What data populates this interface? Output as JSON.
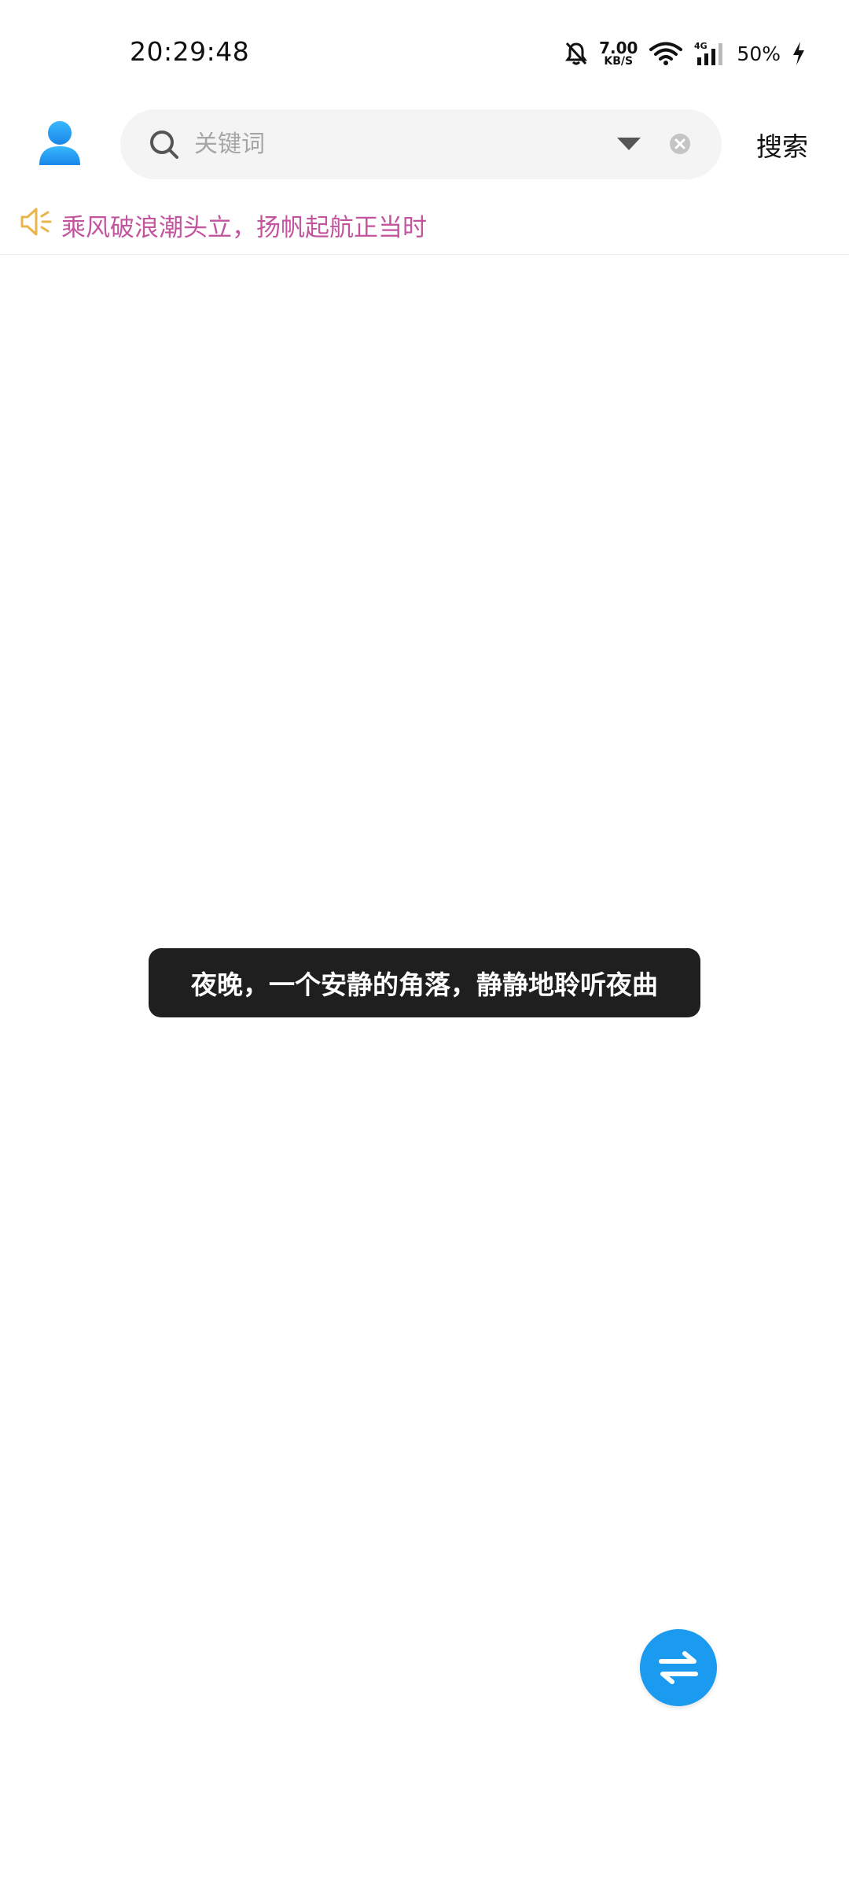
{
  "status_bar": {
    "time": "20:29:48",
    "net_speed_value": "7.00",
    "net_speed_unit": "KB/S",
    "battery_percent": "50%",
    "icons": [
      "bell-muted-icon",
      "wifi-icon",
      "signal-4g-icon",
      "charging-icon"
    ]
  },
  "header": {
    "search": {
      "placeholder": "关键词",
      "value": ""
    },
    "search_button_label": "搜索",
    "icons": [
      "user-avatar-icon",
      "search-icon",
      "dropdown-icon",
      "clear-icon"
    ]
  },
  "notice": {
    "text": "乘风破浪潮头立，扬帆起航正当时",
    "icon": "speaker-icon"
  },
  "toast": {
    "text": "夜晚，一个安静的角落，静静地聆听夜曲"
  },
  "fab": {
    "icon": "swap-arrows-icon"
  },
  "colors": {
    "accent": "#1a9bf0",
    "notice_text": "#c2559e",
    "speaker": "#e9b54a",
    "toast_bg": "#1f1f1f",
    "search_bg": "#f4f4f4"
  }
}
